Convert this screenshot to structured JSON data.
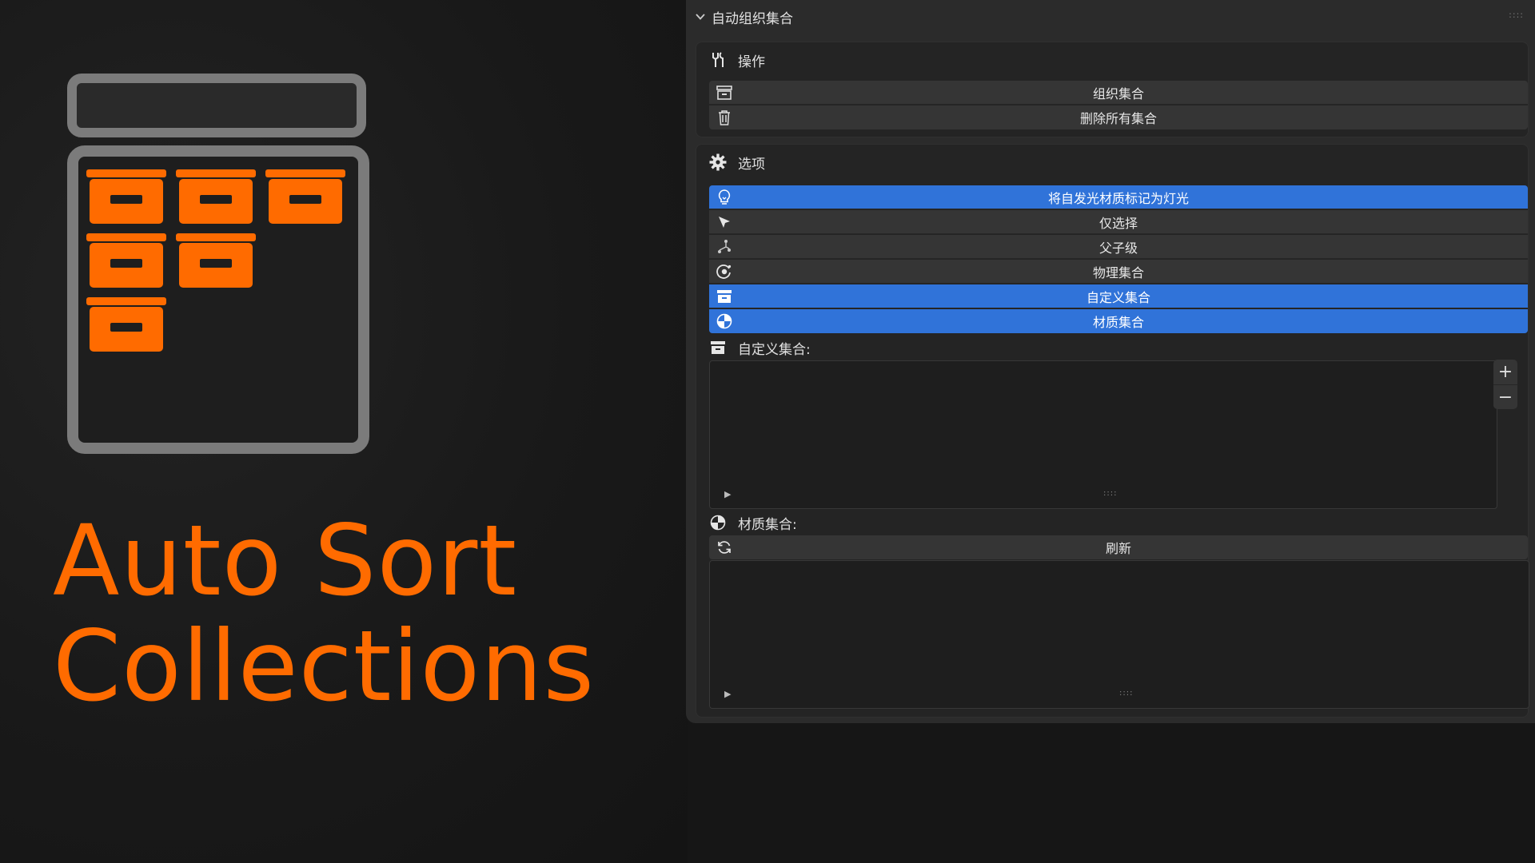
{
  "hero": {
    "title_line1": "Auto Sort",
    "title_line2": "Collections",
    "accent_color": "#ff6b00"
  },
  "panel": {
    "header": "自动组织集合",
    "operations": {
      "title": "操作",
      "title_icon": "tools-icon",
      "buttons": [
        {
          "label": "组织集合",
          "icon": "collection-box-icon"
        },
        {
          "label": "删除所有集合",
          "icon": "trash-icon"
        }
      ]
    },
    "options": {
      "title": "选项",
      "title_icon": "gear-icon",
      "toggles": [
        {
          "label": "将自发光材质标记为灯光",
          "icon": "lightbulb-icon",
          "active": true
        },
        {
          "label": "仅选择",
          "icon": "cursor-icon",
          "active": false
        },
        {
          "label": "父子级",
          "icon": "hierarchy-icon",
          "active": false
        },
        {
          "label": "物理集合",
          "icon": "physics-icon",
          "active": false
        },
        {
          "label": "自定义集合",
          "icon": "collection-box-icon",
          "active": true
        },
        {
          "label": "材质集合",
          "icon": "material-sphere-icon",
          "active": true
        }
      ],
      "active_color": "#3073d9"
    },
    "custom_collections": {
      "label": "自定义集合:",
      "add_symbol": "+",
      "remove_symbol": "−",
      "expand_symbol": "▶",
      "grip_symbol": "::::"
    },
    "material_collections": {
      "label": "材质集合:",
      "refresh_label": "刷新",
      "expand_symbol": "▶",
      "grip_symbol": "::::"
    },
    "grip_symbol": "::::"
  }
}
